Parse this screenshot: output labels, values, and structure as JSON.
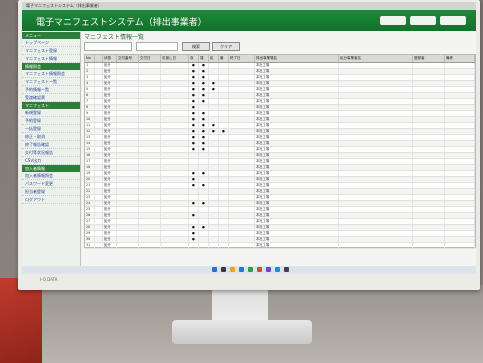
{
  "app": {
    "window_title": "電子マニフェストシステム（排出事業者）",
    "header_title": "電子マニフェストシステム（排出事業者）",
    "header_buttons": [
      "",
      "",
      ""
    ],
    "screen_title": "マニフェスト情報一覧"
  },
  "toolbar": {
    "search_label": "検索",
    "clear_label": "クリア"
  },
  "sidebar": {
    "sections": [
      {
        "title": "メニュー",
        "color": "#2f7d3a",
        "items": [
          "トップページ",
          "マニフェスト登録",
          "マニフェスト情報"
        ]
      },
      {
        "title": "情報照会",
        "color": "#2f7d3a",
        "items": [
          "マニフェスト情報照会",
          "マニフェスト一覧",
          "予約情報一覧",
          "受渡確認票"
        ]
      },
      {
        "title": "マニフェスト",
        "color": "#2f7d3a",
        "items": [
          "新規登録",
          "予約登録",
          "一括登録",
          "修正・取消",
          "終了報告確認",
          "交付等状況報告",
          "CSV出力"
        ]
      },
      {
        "title": "加入者情報",
        "color": "#2f7d3a",
        "items": [
          "加入者情報照会",
          "パスワード変更",
          "担当者登録",
          "ログアウト"
        ]
      }
    ]
  },
  "table": {
    "headers": [
      "No",
      "",
      "状態",
      "交付番号",
      "交付日",
      "引渡し日",
      "収",
      "運",
      "処",
      "最",
      "終了日",
      "排出事業場名",
      "処分事業者名",
      "登録者",
      "備考"
    ],
    "rows": [
      [
        "1",
        "",
        "処分",
        "",
        "",
        "",
        "●",
        "●",
        "",
        "",
        "",
        "本社工場",
        "",
        "",
        ""
      ],
      [
        "2",
        "",
        "処分",
        "",
        "",
        "",
        "●",
        "●",
        "",
        "",
        "",
        "本社工場",
        "",
        "",
        ""
      ],
      [
        "3",
        "",
        "処分",
        "",
        "",
        "",
        "●",
        "●",
        "",
        "",
        "",
        "本社工場",
        "",
        "",
        ""
      ],
      [
        "4",
        "",
        "処分",
        "",
        "",
        "",
        "●",
        "●",
        "●",
        "",
        "",
        "本社工場",
        "",
        "",
        ""
      ],
      [
        "5",
        "",
        "処分",
        "",
        "",
        "",
        "●",
        "●",
        "●",
        "",
        "",
        "本社工場",
        "",
        "",
        ""
      ],
      [
        "6",
        "",
        "処分",
        "",
        "",
        "",
        "●",
        "●",
        "",
        "",
        "",
        "本社工場",
        "",
        "",
        ""
      ],
      [
        "7",
        "",
        "処分",
        "",
        "",
        "",
        "●",
        "●",
        "",
        "",
        "",
        "本社工場",
        "",
        "",
        ""
      ],
      [
        "8",
        "",
        "処分",
        "",
        "",
        "",
        "●",
        "",
        "",
        "",
        "",
        "本社工場",
        "",
        "",
        ""
      ],
      [
        "9",
        "",
        "処分",
        "",
        "",
        "",
        "●",
        "●",
        "",
        "",
        "",
        "本社工場",
        "",
        "",
        ""
      ],
      [
        "10",
        "",
        "処分",
        "",
        "",
        "",
        "●",
        "●",
        "",
        "",
        "",
        "本社工場",
        "",
        "",
        ""
      ],
      [
        "11",
        "",
        "処分",
        "",
        "",
        "",
        "●",
        "●",
        "●",
        "",
        "",
        "本社工場",
        "",
        "",
        ""
      ],
      [
        "12",
        "",
        "処分",
        "",
        "",
        "",
        "●",
        "●",
        "●",
        "●",
        "",
        "本社工場",
        "",
        "",
        ""
      ],
      [
        "13",
        "",
        "処分",
        "",
        "",
        "",
        "●",
        "●",
        "",
        "",
        "",
        "本社工場",
        "",
        "",
        ""
      ],
      [
        "14",
        "",
        "処分",
        "",
        "",
        "",
        "●",
        "●",
        "",
        "",
        "",
        "本社工場",
        "",
        "",
        ""
      ],
      [
        "15",
        "",
        "処分",
        "",
        "",
        "",
        "●",
        "●",
        "",
        "",
        "",
        "本社工場",
        "",
        "",
        ""
      ],
      [
        "16",
        "",
        "処分",
        "",
        "",
        "",
        "",
        "",
        "",
        "",
        "",
        "本社工場",
        "",
        "",
        ""
      ],
      [
        "17",
        "",
        "処分",
        "",
        "",
        "",
        "",
        "",
        "",
        "",
        "",
        "本社工場",
        "",
        "",
        ""
      ],
      [
        "18",
        "",
        "処分",
        "",
        "",
        "",
        "",
        "",
        "",
        "",
        "",
        "本社工場",
        "",
        "",
        ""
      ],
      [
        "19",
        "",
        "処分",
        "",
        "",
        "",
        "●",
        "●",
        "",
        "",
        "",
        "本社工場",
        "",
        "",
        ""
      ],
      [
        "20",
        "",
        "処分",
        "",
        "",
        "",
        "●",
        "",
        "",
        "",
        "",
        "本社工場",
        "",
        "",
        ""
      ],
      [
        "21",
        "",
        "処分",
        "",
        "",
        "",
        "●",
        "●",
        "",
        "",
        "",
        "本社工場",
        "",
        "",
        ""
      ],
      [
        "22",
        "",
        "処分",
        "",
        "",
        "",
        "",
        "",
        "",
        "",
        "",
        "本社工場",
        "",
        "",
        ""
      ],
      [
        "23",
        "",
        "処分",
        "",
        "",
        "",
        "",
        "",
        "",
        "",
        "",
        "本社工場",
        "",
        "",
        ""
      ],
      [
        "24",
        "",
        "処分",
        "",
        "",
        "",
        "●",
        "●",
        "",
        "",
        "",
        "本社工場",
        "",
        "",
        ""
      ],
      [
        "25",
        "",
        "処分",
        "",
        "",
        "",
        "",
        "",
        "",
        "",
        "",
        "本社工場",
        "",
        "",
        ""
      ],
      [
        "26",
        "",
        "処分",
        "",
        "",
        "",
        "●",
        "",
        "",
        "",
        "",
        "本社工場",
        "",
        "",
        ""
      ],
      [
        "27",
        "",
        "処分",
        "",
        "",
        "",
        "",
        "",
        "",
        "",
        "",
        "本社工場",
        "",
        "",
        ""
      ],
      [
        "28",
        "",
        "処分",
        "",
        "",
        "",
        "●",
        "●",
        "",
        "",
        "",
        "本社工場",
        "",
        "",
        ""
      ],
      [
        "29",
        "",
        "処分",
        "",
        "",
        "",
        "●",
        "",
        "",
        "",
        "",
        "本社工場",
        "",
        "",
        ""
      ],
      [
        "30",
        "",
        "処分",
        "",
        "",
        "",
        "●",
        "",
        "",
        "",
        "",
        "本社工場",
        "",
        "",
        ""
      ],
      [
        "31",
        "",
        "処分",
        "",
        "",
        "",
        "",
        "",
        "",
        "",
        "",
        "本社工場",
        "",
        "",
        ""
      ]
    ]
  },
  "taskbar": {
    "icon_colors": [
      "#2b6fd6",
      "#3b3b3b",
      "#e8a321",
      "#1f7bd1",
      "#2f9e4a",
      "#d14b3a",
      "#6d49c9",
      "#1c8fd8",
      "#444"
    ]
  },
  "monitor": {
    "brand": "I-O DATA"
  }
}
